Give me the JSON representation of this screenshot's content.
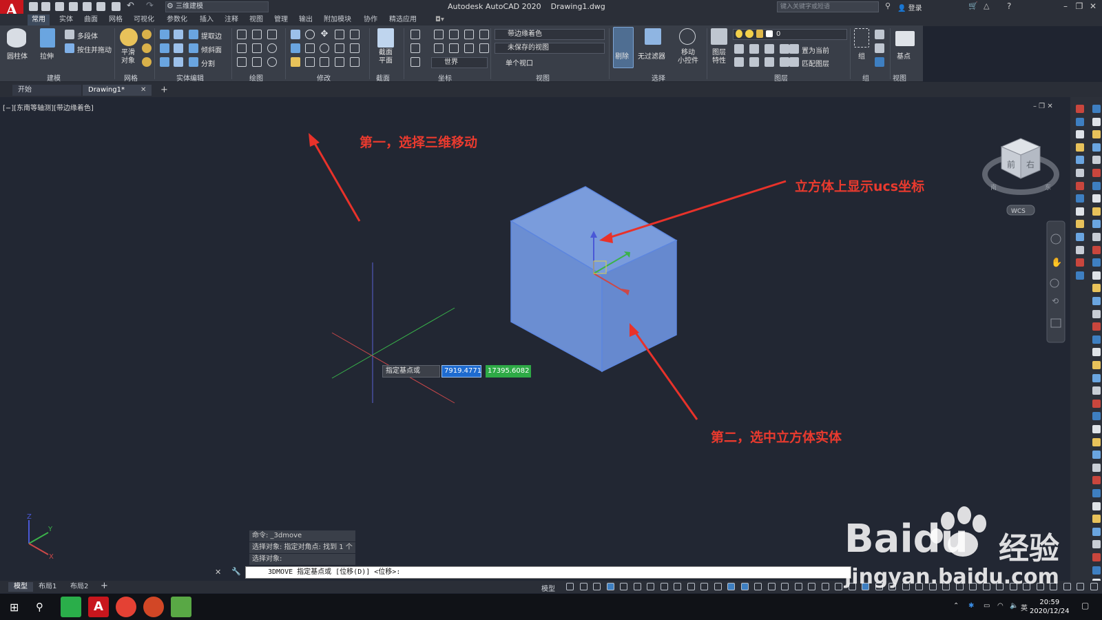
{
  "titlebar": {
    "app_title": "Autodesk AutoCAD 2020",
    "file_name": "Drawing1.dwg",
    "workspace": "三维建模",
    "search_placeholder": "键入关键字或短语",
    "login": "登录"
  },
  "ribbon_tabs": [
    "常用",
    "实体",
    "曲面",
    "网格",
    "可视化",
    "参数化",
    "插入",
    "注释",
    "视图",
    "管理",
    "输出",
    "附加模块",
    "协作",
    "精选应用"
  ],
  "ribbon": {
    "modeling": {
      "cylinder": "圆柱体",
      "extrude": "拉伸",
      "polysolid": "多段体",
      "presspull": "按住并拖动",
      "label": "建模"
    },
    "mesh": {
      "smooth": "平滑",
      "smooth2": "对象",
      "label": "网格"
    },
    "solid_edit": {
      "extract": "提取边",
      "taper": "倾斜面",
      "separate": "分割",
      "label": "实体编辑"
    },
    "draw": {
      "label": "绘图"
    },
    "modify": {
      "label": "修改"
    },
    "section": {
      "section_plane": "截面",
      "section_plane2": "平面",
      "label": "截面"
    },
    "coordinates": {
      "world": "世界",
      "label": "坐标"
    },
    "view": {
      "visual_style": "带边缘着色",
      "saved_view": "未保存的视图",
      "viewport": "单个视口",
      "label": "视图"
    },
    "selection": {
      "cull": "剔除",
      "no_filter": "无过滤器",
      "gizmo": "移动",
      "gizmo2": "小控件",
      "label": "选择"
    },
    "layers": {
      "layer_props": "图层",
      "layer_props2": "特性",
      "current_layer": "0",
      "set_current": "置为当前",
      "match_layer": "匹配图层",
      "label": "图层"
    },
    "groups": {
      "group": "组",
      "label": "组"
    },
    "view2": {
      "base": "基点",
      "label": "视图"
    }
  },
  "doc_tabs": {
    "start": "开始",
    "drawing": "Drawing1*"
  },
  "viewport": {
    "label": "[−][东南等轴测][带边缘着色]",
    "viewcube_front": "前",
    "viewcube_right": "右",
    "compass_s": "南",
    "compass_e": "东",
    "wcs": "WCS",
    "ucs_z": "Z",
    "ucs_y": "Y",
    "ucs_x": "X"
  },
  "dynamic_input": {
    "prompt": "指定基点或",
    "x_value": "7919.4771",
    "y_value": "17395.6082"
  },
  "annotations": {
    "step1": "第一，选择三维移动",
    "ucs_note": "立方体上显示ucs坐标",
    "step2": "第二，选中立方体实体"
  },
  "command": {
    "history": [
      "命令: _3dmove",
      "选择对象: 指定对角点: 找到 1 个",
      "选择对象:"
    ],
    "prompt": "3DMOVE 指定基点或 [位移(D)] <位移>:"
  },
  "layout_tabs": [
    "模型",
    "布局1",
    "布局2"
  ],
  "status": {
    "model": "模型"
  },
  "taskbar": {
    "time": "20:59",
    "date": "2020/12/24",
    "ime": "英"
  },
  "watermark": {
    "brand": "Baidu",
    "jingyan": "经验",
    "url": "jingyan.baidu.com"
  },
  "colors": {
    "accent": "#c8161d",
    "annotation": "#ea3a2e",
    "cube_fill": "#6c8fd3",
    "input_blue": "#1e6bd0",
    "input_green": "#2eaa46"
  }
}
